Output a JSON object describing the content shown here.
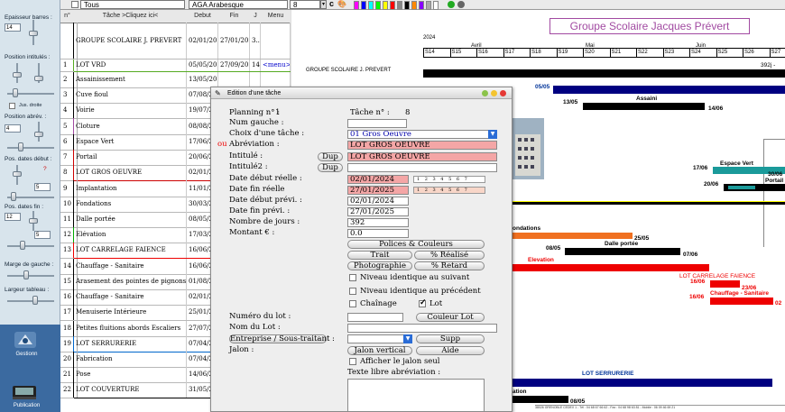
{
  "toolbar": {
    "filter_value": "Tous",
    "font_value": "AGA Arabesque",
    "size_value": "8",
    "swatches": [
      "#ff00ff",
      "#0000ff",
      "#00ffff",
      "#00ff00",
      "#ffff00",
      "#ff0000",
      "#888888",
      "#000000",
      "#ff8800",
      "#8800ff",
      "#aaaaaa",
      "#ffffff"
    ]
  },
  "left_panel": {
    "epaisseur_label": "Epaisseur barres :",
    "epaisseur_value": "14",
    "position_intitules_label": "Position intitulés :",
    "jus_droite_label": "Jus. droite",
    "position_abrev_label": "Position abrév. :",
    "position_abrev_value": "4",
    "pos_dates_debut_label": "Pos. dates début :",
    "pos_dates_debut_value": "5",
    "pos_dates_fin_label": "Pos. dates fin :",
    "pos_dates_fin_value_1": "12",
    "pos_dates_fin_value_2": "5",
    "marge_label": "Marge de gauche :",
    "largeur_label": "Largeur tableau :",
    "dock_item_1": "Gestionn",
    "dock_item_2": "Publication"
  },
  "table": {
    "headers": {
      "num": "n°",
      "tache": "Tâche >Cliquez ici<",
      "debut": "Debut",
      "fin": "Fin",
      "j": "J",
      "menu": "Menu"
    },
    "rows": [
      {
        "num": "",
        "tache": "GROUPE SCOLAIRE J. PREVERT",
        "debut": "02/01/2024",
        "fin": "27/01/2025",
        "j": "3...",
        "menu": ""
      },
      {
        "num": "1",
        "tache": "LOT VRD",
        "debut": "05/05/2024",
        "fin": "27/09/2024",
        "j": "146",
        "menu": "<menu>"
      },
      {
        "num": "2",
        "tache": "Assainissement",
        "debut": "13/05/20",
        "fin": "",
        "j": "",
        "menu": ""
      },
      {
        "num": "3",
        "tache": "Cuve fioul",
        "debut": "07/08/20",
        "fin": "",
        "j": "",
        "menu": ""
      },
      {
        "num": "4",
        "tache": "Voirie",
        "debut": "19/07/20",
        "fin": "",
        "j": "",
        "menu": ""
      },
      {
        "num": "5",
        "tache": "Cloture",
        "debut": "08/08/20",
        "fin": "",
        "j": "",
        "menu": ""
      },
      {
        "num": "6",
        "tache": "Espace Vert",
        "debut": "17/06/20",
        "fin": "",
        "j": "",
        "menu": ""
      },
      {
        "num": "7",
        "tache": "Portail",
        "debut": "20/06/20",
        "fin": "",
        "j": "",
        "menu": ""
      },
      {
        "num": "8",
        "tache": "LOT GROS OEUVRE",
        "debut": "02/01/20",
        "fin": "",
        "j": "",
        "menu": ""
      },
      {
        "num": "9",
        "tache": "Implantation",
        "debut": "11/01/20",
        "fin": "",
        "j": "",
        "menu": ""
      },
      {
        "num": "10",
        "tache": "Fondations",
        "debut": "30/03/20",
        "fin": "",
        "j": "",
        "menu": ""
      },
      {
        "num": "11",
        "tache": "Dalle portée",
        "debut": "08/05/20",
        "fin": "",
        "j": "",
        "menu": ""
      },
      {
        "num": "12",
        "tache": "Elévation",
        "debut": "17/03/20",
        "fin": "",
        "j": "",
        "menu": ""
      },
      {
        "num": "13",
        "tache": "LOT CARRELAGE FAIENCE",
        "debut": "16/06/20",
        "fin": "",
        "j": "",
        "menu": ""
      },
      {
        "num": "14",
        "tache": "Chauffage - Sanitaire",
        "debut": "16/06/20",
        "fin": "",
        "j": "",
        "menu": ""
      },
      {
        "num": "15",
        "tache": "Arasement des pointes  de pignons",
        "debut": "01/08/20",
        "fin": "",
        "j": "",
        "menu": ""
      },
      {
        "num": "16",
        "tache": "Chauffage - Sanitaire",
        "debut": "02/01/20",
        "fin": "",
        "j": "",
        "menu": ""
      },
      {
        "num": "17",
        "tache": "Menuiserie Intérieure",
        "debut": "25/01/20",
        "fin": "",
        "j": "",
        "menu": ""
      },
      {
        "num": "18",
        "tache": "Petites fluitions abords Escaliers",
        "debut": "27/07/20",
        "fin": "",
        "j": "",
        "menu": ""
      },
      {
        "num": "19",
        "tache": "LOT SERRURERIE",
        "debut": "07/04/20",
        "fin": "",
        "j": "",
        "menu": ""
      },
      {
        "num": "20",
        "tache": "Fabrication",
        "debut": "07/04/20",
        "fin": "",
        "j": "",
        "menu": ""
      },
      {
        "num": "21",
        "tache": "Pose",
        "debut": "14/06/20",
        "fin": "",
        "j": "",
        "menu": ""
      },
      {
        "num": "22",
        "tache": "LOT COUVERTURE",
        "debut": "31/05/20",
        "fin": "",
        "j": "",
        "menu": ""
      }
    ]
  },
  "gantt": {
    "title": "Groupe Scolaire Jacques Prévert",
    "year": "2024",
    "months": [
      "Avril",
      "Mai",
      "Juin"
    ],
    "weeks": [
      "S14",
      "S15",
      "S16",
      "S17",
      "S18",
      "S19",
      "S20",
      "S21",
      "S22",
      "S23",
      "S24",
      "S25",
      "S26",
      "S27"
    ],
    "project_label": "GROUPE SCOLAIRE J. PREVERT",
    "labels": {
      "d1": "392j -",
      "d2": "05/05",
      "assain": "Assaini",
      "d3": "13/05",
      "d4": "14/06",
      "espace": "Espace Vert",
      "d5": "17/06",
      "d6": "30/06",
      "portail": "Portail",
      "d7": "20/06",
      "fond": "ondations",
      "d8": "25/05",
      "dalle": "Dalle portée",
      "d9": "08/05",
      "d10": "07/06",
      "elev": "Elevation",
      "carrelage": "LOT CARRELAGE FAIENCE",
      "d11": "16/06",
      "d12": "23/06",
      "d13": "16/06",
      "chauff": "Chauffage - Sanitaire",
      "d14": "02",
      "serr": "LOT SERRURERIE",
      "ation": "ation",
      "d15": "08/05",
      "footer": "38026 GRENOBLE CEDEX 1 - Tél : 04 68 67 66 62 - Fax : 04 68 98 63 81 - Mobile : 06 09 46 69 21"
    }
  },
  "dialog": {
    "title": "Edition d'une tâche",
    "planning_label": "Planning n° :",
    "planning_value": "1",
    "tache_label": "Tâche n° :",
    "tache_value": "8",
    "num_gauche_label": "Num gauche :",
    "choix_label": "Choix d'une tâche :",
    "choix_value": "01 Gros Oeuvre",
    "ou_label": "ou",
    "abrev_label": "Abréviation :",
    "abrev_value": "LOT GROS OEUVRE",
    "intitule_label": "Intitulé :",
    "intitule_value": "LOT GROS OEUVRE",
    "intitule2_label": "Intitulé2 :",
    "dup_label": "Dup",
    "date_debut_reelle_label": "Date début réelle :",
    "date_debut_reelle_value": "02/01/2024",
    "date_fin_reelle_label": "Date fin réelle",
    "date_fin_reelle_value": "27/01/2025",
    "date_debut_prevu_label": "Date début prévi. :",
    "date_debut_prevu_value": "02/01/2024",
    "date_fin_prevu_label": "Date fin prévi. :",
    "date_fin_prevu_value": "27/01/2025",
    "nb_jours_label": "Nombre de jours :",
    "nb_jours_value": "392",
    "montant_label": "Montant € :",
    "montant_value": "0.0",
    "cal_days": "1 2 3 4 5 6 7",
    "polices_btn": "Polices  &  Couleurs",
    "trait_btn": "Trait",
    "realise_btn": "% Réalisé",
    "photo_btn": "Photographie",
    "retard_btn": "% Retard",
    "niveau_suivant": "Niveau identique au suivant",
    "niveau_precedent": "Niveau identique au précédent",
    "chainage": "Chaînage",
    "lot": "Lot",
    "numero_lot_label": "Numéro du lot :",
    "couleur_lot_btn": "Couleur Lot",
    "nom_lot_label": "Nom du Lot :",
    "entreprise_btn": "Entreprise / Sous-traitant :",
    "supp_btn": "Supp",
    "jalon_label": "Jalon :",
    "jalon_vertical_btn": "Jalon vertical",
    "aide_btn": "Aide",
    "afficher_jalon": "Afficher le jalon seul",
    "texte_libre_label": "Texte libre abréviation :"
  }
}
